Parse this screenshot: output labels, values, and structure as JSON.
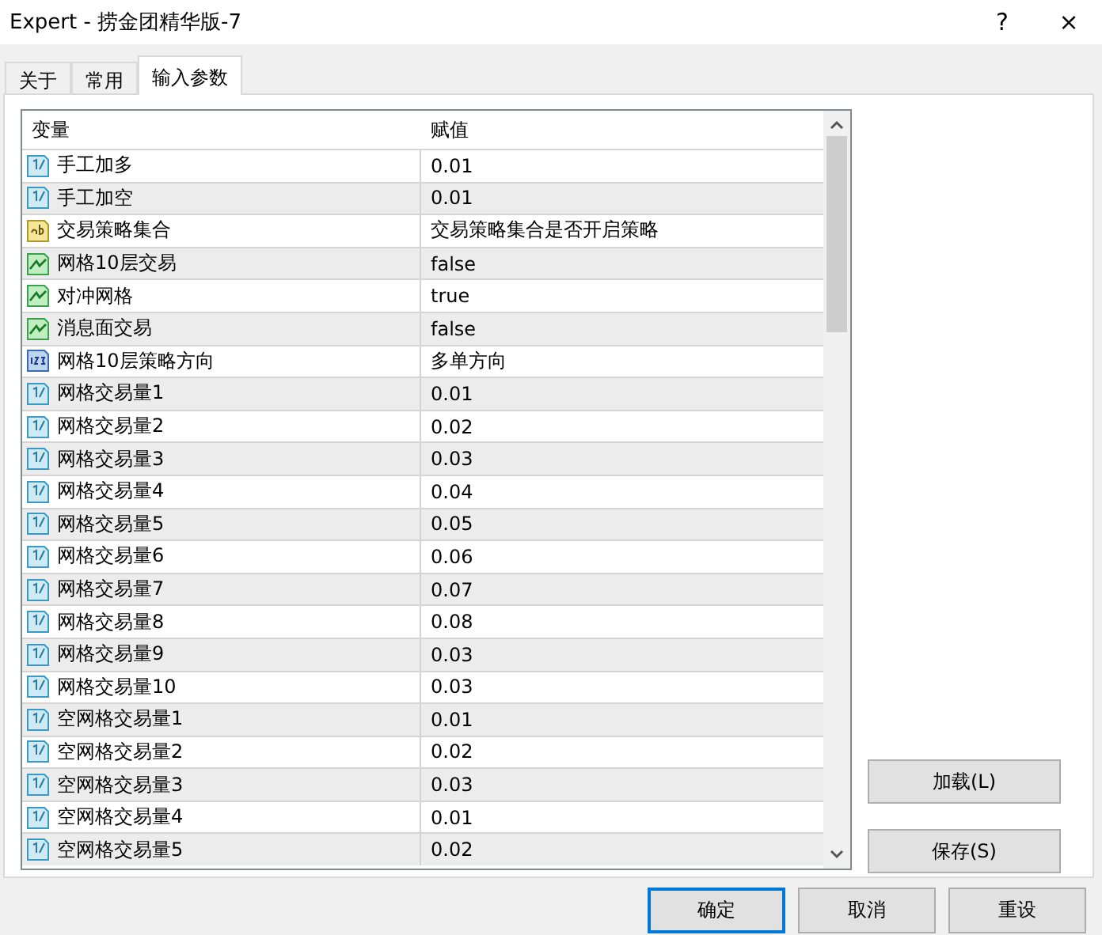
{
  "window": {
    "title": "Expert - 捞金团精华版-7",
    "help": "?",
    "close": "×"
  },
  "tabs": [
    {
      "label": "关于",
      "selected": false
    },
    {
      "label": "常用",
      "selected": false
    },
    {
      "label": "输入参数",
      "selected": true
    }
  ],
  "table": {
    "columns": [
      "变量",
      "赋值"
    ],
    "rows": [
      {
        "kind": "double",
        "name": "手工加多",
        "value": "0.01"
      },
      {
        "kind": "double",
        "name": "手工加空",
        "value": "0.01"
      },
      {
        "kind": "string",
        "name": "交易策略集合",
        "value": "交易策略集合是否开启策略"
      },
      {
        "kind": "bool",
        "name": "网格10层交易",
        "value": "false"
      },
      {
        "kind": "bool",
        "name": "对冲网格",
        "value": "true"
      },
      {
        "kind": "bool",
        "name": "消息面交易",
        "value": "false"
      },
      {
        "kind": "int",
        "name": "网格10层策略方向",
        "value": "多单方向"
      },
      {
        "kind": "double",
        "name": "网格交易量1",
        "value": "0.01"
      },
      {
        "kind": "double",
        "name": "网格交易量2",
        "value": "0.02"
      },
      {
        "kind": "double",
        "name": "网格交易量3",
        "value": "0.03"
      },
      {
        "kind": "double",
        "name": "网格交易量4",
        "value": "0.04"
      },
      {
        "kind": "double",
        "name": "网格交易量5",
        "value": "0.05"
      },
      {
        "kind": "double",
        "name": "网格交易量6",
        "value": "0.06"
      },
      {
        "kind": "double",
        "name": "网格交易量7",
        "value": "0.07"
      },
      {
        "kind": "double",
        "name": "网格交易量8",
        "value": "0.08"
      },
      {
        "kind": "double",
        "name": "网格交易量9",
        "value": "0.03"
      },
      {
        "kind": "double",
        "name": "网格交易量10",
        "value": "0.03"
      },
      {
        "kind": "double",
        "name": "空网格交易量1",
        "value": "0.01"
      },
      {
        "kind": "double",
        "name": "空网格交易量2",
        "value": "0.02"
      },
      {
        "kind": "double",
        "name": "空网格交易量3",
        "value": "0.03"
      },
      {
        "kind": "double",
        "name": "空网格交易量4",
        "value": "0.01"
      },
      {
        "kind": "double",
        "name": "空网格交易量5",
        "value": "0.02"
      }
    ]
  },
  "side_buttons": [
    "加载(L)",
    "保存(S)"
  ],
  "buttons": [
    {
      "label": "确定",
      "default": true
    },
    {
      "label": "取消",
      "default": false
    },
    {
      "label": "重设",
      "default": false
    }
  ]
}
